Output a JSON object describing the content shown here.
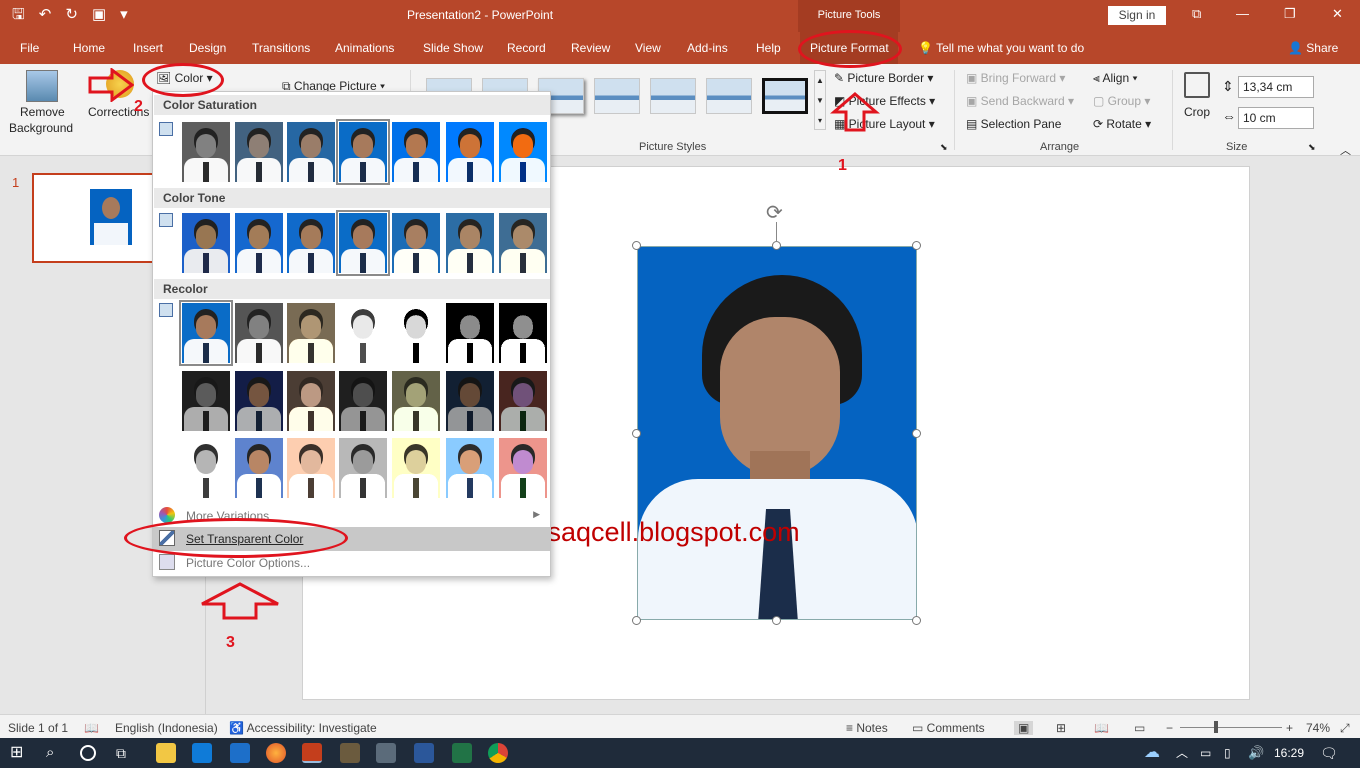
{
  "titlebar": {
    "title": "Presentation2 - PowerPoint",
    "context_tab_group": "Picture Tools",
    "signin": "Sign in"
  },
  "tabs": [
    "File",
    "Home",
    "Insert",
    "Design",
    "Transitions",
    "Animations",
    "Slide Show",
    "Record",
    "Review",
    "View",
    "Add-ins",
    "Help",
    "Picture Format"
  ],
  "tellme": "Tell me what you want to do",
  "share": "Share",
  "ribbon": {
    "remove_bg_line1": "Remove",
    "remove_bg_line2": "Background",
    "corrections": "Corrections",
    "color": "Color",
    "change_picture": "Change Picture",
    "picture_border": "Picture Border",
    "picture_effects": "Picture Effects",
    "picture_layout": "Picture Layout",
    "picture_styles_label": "Picture Styles",
    "bring_forward": "Bring Forward",
    "send_backward": "Send Backward",
    "selection_pane": "Selection Pane",
    "align": "Align",
    "group": "Group",
    "rotate": "Rotate",
    "arrange_label": "Arrange",
    "crop": "Crop",
    "height": "13,34 cm",
    "width": "10 cm",
    "size_label": "Size"
  },
  "thumbnail": {
    "slide_number": "1"
  },
  "dropdown": {
    "color_saturation": "Color Saturation",
    "color_tone": "Color Tone",
    "recolor": "Recolor",
    "more_variations": "More Variations",
    "set_transparent": "Set Transparent Color",
    "color_options": "Picture Color Options..."
  },
  "watermark": "bisnisaqcell.blogspot.com",
  "annotations": {
    "n1": "1",
    "n2": "2",
    "n3": "3"
  },
  "status": {
    "slide": "Slide 1 of 1",
    "language": "English (Indonesia)",
    "accessibility": "Accessibility: Investigate",
    "notes": "Notes",
    "comments": "Comments",
    "zoom": "74%"
  },
  "taskbar": {
    "time": "16:29"
  },
  "colors": {
    "accent": "#b7472a",
    "annotation": "#e0141e",
    "photo_bg": "#0563c1"
  }
}
